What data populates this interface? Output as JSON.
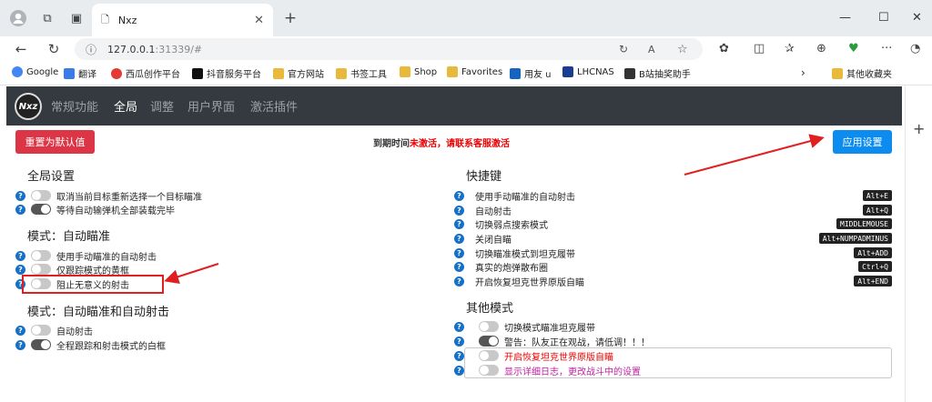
{
  "browser": {
    "tab_title": "Nxz",
    "url_host": "127.0.0.1",
    "url_port_path": ":31339/#"
  },
  "bookmarks": [
    {
      "label": "Google",
      "color": "#4285f4"
    },
    {
      "label": "翻译",
      "color": "#3b7be8"
    },
    {
      "label": "西瓜创作平台",
      "color": "#e53935"
    },
    {
      "label": "抖音服务平台",
      "color": "#111111"
    },
    {
      "label": "官方网站",
      "color": "#e8b93a"
    },
    {
      "label": "书签工具",
      "color": "#e8b93a"
    },
    {
      "label": "Shop",
      "color": "#e8b93a"
    },
    {
      "label": "Favorites",
      "color": "#e8b93a"
    },
    {
      "label": "用友 u",
      "color": "#1565c0"
    },
    {
      "label": "LHCNAS",
      "color": "#1a3d8f"
    },
    {
      "label": "B站抽奖助手",
      "color": "#333333"
    },
    {
      "label": "其他收藏夹",
      "color": "#e8b93a"
    }
  ],
  "nav": {
    "logo": "Nxz",
    "items": [
      "常规功能",
      "全局",
      "调整",
      "用户界面",
      "激活插件"
    ]
  },
  "actions": {
    "reset": "重置为默认值",
    "apply": "应用设置",
    "expiry_prefix": "到期时间",
    "expiry_status": "未激活，请联系客服激活"
  },
  "left": {
    "global_title": "全局设置",
    "global_items": [
      {
        "label": "取消当前目标重新选择一个目标瞄准",
        "on": false
      },
      {
        "label": "等待自动输弹机全部装载完毕",
        "on": true
      }
    ],
    "auto_aim_title": "模式：自动瞄准",
    "auto_aim_items": [
      {
        "label": "使用手动瞄准的自动射击",
        "on": false
      },
      {
        "label": "仅跟踪模式的黄框",
        "on": false
      },
      {
        "label": "阻止无意义的射击",
        "on": false
      }
    ],
    "aim_shoot_title": "模式：自动瞄准和自动射击",
    "aim_shoot_items": [
      {
        "label": "自动射击",
        "on": false
      },
      {
        "label": "全程跟踪和射击模式的白框",
        "on": true
      }
    ]
  },
  "right": {
    "hotkey_title": "快捷键",
    "hotkeys": [
      {
        "label": "使用手动瞄准的自动射击",
        "key": "Alt+E"
      },
      {
        "label": "自动射击",
        "key": "Alt+Q"
      },
      {
        "label": "切换弱点搜索模式",
        "key": "MIDDLEMOUSE"
      },
      {
        "label": "关闭自瞄",
        "key": "Alt+NUMPADMINUS"
      },
      {
        "label": "切换瞄准模式到坦克履带",
        "key": "Alt+ADD"
      },
      {
        "label": "真实的炮弹散布圈",
        "key": "Ctrl+Q"
      },
      {
        "label": "开启恢复坦克世界原版自瞄",
        "key": "Alt+END"
      }
    ],
    "other_title": "其他模式",
    "other_items": [
      {
        "label": "切换模式瞄准坦克履带",
        "on": false
      },
      {
        "label": "警告：队友正在观战，请低调！！！",
        "on": true
      },
      {
        "label": "开启恢复坦克世界原版自瞄",
        "on": false
      },
      {
        "label": "显示详细日志，更改战斗中的设置",
        "on": false
      }
    ]
  }
}
